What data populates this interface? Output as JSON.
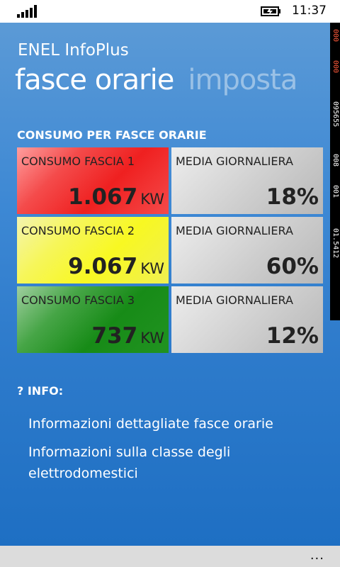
{
  "status_bar": {
    "time": "11:37",
    "signal_icon": "signal-strength-icon",
    "battery_icon": "battery-charging-icon"
  },
  "app": {
    "title": "ENEL InfoPlus",
    "pivots": [
      "fasce orarie",
      "imposta"
    ]
  },
  "consumption": {
    "header": "CONSUMO PER FASCE ORARIE",
    "rows": [
      {
        "label": "CONSUMO FASCIA 1",
        "value": "1.067",
        "unit": "KW",
        "media_label": "MEDIA GIORNALIERA",
        "media_value": "18%",
        "color": "#ef2020"
      },
      {
        "label": "CONSUMO FASCIA 2",
        "value": "9.067",
        "unit": "KW",
        "media_label": "MEDIA GIORNALIERA",
        "media_value": "60%",
        "color": "#f8f822"
      },
      {
        "label": "CONSUMO FASCIA 3",
        "value": "737",
        "unit": "KW",
        "media_label": "MEDIA GIORNALIERA",
        "media_value": "12%",
        "color": "#178b17"
      }
    ]
  },
  "info": {
    "header": "? INFO:",
    "links": [
      "Informazioni dettagliate fasce orarie",
      "Informazioni sulla classe degli elettrodomestici"
    ]
  },
  "debug_counters": [
    "000",
    "000",
    "095655",
    "008",
    "001",
    "01.5412"
  ],
  "app_bar": {
    "more_label": "...",
    "more_icon": "ellipsis-icon"
  },
  "colors": {
    "accent": "#2f7ccc",
    "text": "#ffffff"
  }
}
